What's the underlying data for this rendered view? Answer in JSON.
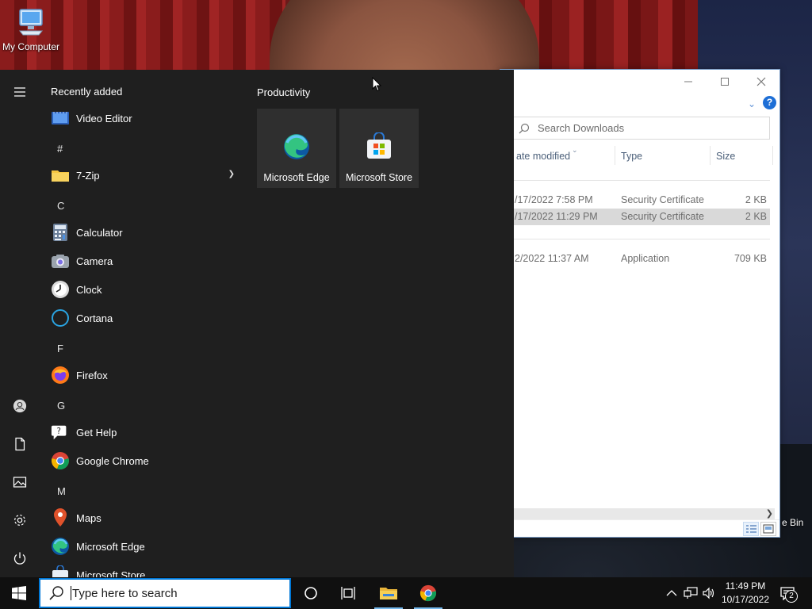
{
  "desktop": {
    "icons": [
      {
        "label": "My Computer",
        "icon": "computer-icon"
      }
    ],
    "recycle_bin_partial_label": "e Bin"
  },
  "explorer": {
    "search_placeholder": "Search Downloads",
    "columns": [
      {
        "label": "ate modified"
      },
      {
        "label": "Type"
      },
      {
        "label": "Size"
      }
    ],
    "rows": [
      {
        "date": "/17/2022 7:58 PM",
        "type": "Security Certificate",
        "size": "2 KB",
        "selected": false
      },
      {
        "date": "/17/2022 11:29 PM",
        "type": "Security Certificate",
        "size": "2 KB",
        "selected": true
      },
      {
        "date": "2/2022 11:37 AM",
        "type": "Application",
        "size": "709 KB",
        "selected": false
      }
    ],
    "accent": "#1e6fd6"
  },
  "start_menu": {
    "recently_added_header": "Recently added",
    "apps": [
      {
        "label": "Video Editor",
        "icon": "video-editor-icon"
      },
      {
        "letter": "#"
      },
      {
        "label": "7-Zip",
        "icon": "folder-icon",
        "expandable": true
      },
      {
        "letter": "C"
      },
      {
        "label": "Calculator",
        "icon": "calculator-icon"
      },
      {
        "label": "Camera",
        "icon": "camera-icon"
      },
      {
        "label": "Clock",
        "icon": "clock-icon"
      },
      {
        "label": "Cortana",
        "icon": "cortana-icon"
      },
      {
        "letter": "F"
      },
      {
        "label": "Firefox",
        "icon": "firefox-icon"
      },
      {
        "letter": "G"
      },
      {
        "label": "Get Help",
        "icon": "get-help-icon"
      },
      {
        "label": "Google Chrome",
        "icon": "chrome-icon"
      },
      {
        "letter": "M"
      },
      {
        "label": "Maps",
        "icon": "maps-icon"
      },
      {
        "label": "Microsoft Edge",
        "icon": "edge-icon"
      },
      {
        "label": "Microsoft Store",
        "icon": "store-icon"
      }
    ],
    "rail": [
      "hamburger-icon",
      "user-icon",
      "documents-icon",
      "pictures-icon",
      "settings-icon",
      "power-icon"
    ],
    "tiles_group": "Productivity",
    "tiles": [
      {
        "label": "Microsoft Edge",
        "icon": "edge-icon"
      },
      {
        "label": "Microsoft Store",
        "icon": "store-icon"
      }
    ]
  },
  "taskbar": {
    "search_placeholder": "Type here to search",
    "pinned": [
      "cortana-circle-icon",
      "task-view-icon",
      "file-explorer-icon",
      "chrome-icon"
    ],
    "time": "11:49 PM",
    "date": "10/17/2022",
    "notification_count": "2",
    "background": "#101010",
    "active_underline": "#76b9ed"
  }
}
